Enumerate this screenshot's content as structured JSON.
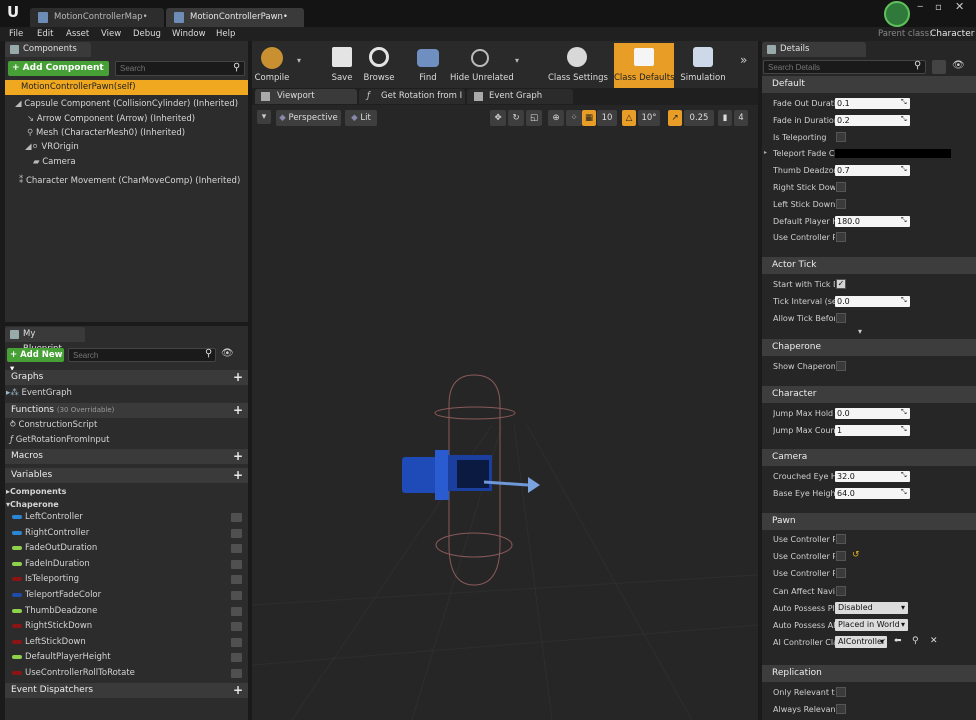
{
  "tabs": [
    {
      "label": "MotionControllerMap•"
    },
    {
      "label": "MotionControllerPawn•"
    }
  ],
  "parent_class": {
    "prefix": "Parent class:",
    "value": "Character"
  },
  "menu": [
    "File",
    "Edit",
    "Asset",
    "View",
    "Debug",
    "Window",
    "Help"
  ],
  "components": {
    "title": "Components",
    "add_label": "+ Add Component ▾",
    "search_placeholder": "Search",
    "root": "MotionControllerPawn(self)",
    "items": [
      "Capsule Component (CollisionCylinder) (Inherited)",
      "Arrow Component (Arrow) (Inherited)",
      "Mesh (CharacterMesh0) (Inherited)",
      "VROrigin",
      "Camera",
      "Character Movement (CharMoveComp) (Inherited)"
    ]
  },
  "blueprint": {
    "title": "My Blueprint",
    "add_label": "+ Add New ▾",
    "search_placeholder": "Search",
    "graphs": "Graphs",
    "event_graph": "EventGraph",
    "functions": "Functions",
    "functions_note": "(30 Overridable)",
    "fn_items": [
      "ConstructionScript",
      "GetRotationFromInput"
    ],
    "macros": "Macros",
    "variables": "Variables",
    "cat_components": "Components",
    "cat_chaperone": "Chaperone",
    "vars": [
      {
        "name": "LeftController",
        "color": "#2b87d6"
      },
      {
        "name": "RightController",
        "color": "#2b87d6"
      },
      {
        "name": "FadeOutDuration",
        "color": "#8ed14a"
      },
      {
        "name": "FadeInDuration",
        "color": "#8ed14a"
      },
      {
        "name": "IsTeleporting",
        "color": "#8b1515"
      },
      {
        "name": "TeleportFadeColor",
        "color": "#1f4ca8"
      },
      {
        "name": "ThumbDeadzone",
        "color": "#8ed14a"
      },
      {
        "name": "RightStickDown",
        "color": "#8b1515"
      },
      {
        "name": "LeftStickDown",
        "color": "#8b1515"
      },
      {
        "name": "DefaultPlayerHeight",
        "color": "#8ed14a"
      },
      {
        "name": "UseControllerRollToRotate",
        "color": "#8b1515"
      }
    ],
    "dispatchers": "Event Dispatchers"
  },
  "toolbar": {
    "compile": "Compile",
    "save": "Save",
    "browse": "Browse",
    "find": "Find",
    "hide": "Hide Unrelated",
    "class_settings": "Class Settings",
    "class_defaults": "Class Defaults",
    "simulation": "Simulation"
  },
  "viewport_tabs": [
    "Viewport",
    "Get Rotation from I",
    "Event Graph"
  ],
  "viewport": {
    "perspective": "Perspective",
    "lit": "Lit",
    "grid": "10",
    "angle": "10°",
    "scale": "0.25",
    "speed": "4"
  },
  "details": {
    "title": "Details",
    "search_placeholder": "Search Details",
    "default": {
      "title": "Default",
      "rows": [
        {
          "label": "Fade Out Duratio",
          "value": "0.1"
        },
        {
          "label": "Fade in Duration",
          "value": "0.2"
        },
        {
          "label": "Is Teleporting"
        },
        {
          "label": "Teleport Fade Co"
        },
        {
          "label": "Thumb Deadzone",
          "value": "0.7"
        },
        {
          "label": "Right Stick Down"
        },
        {
          "label": "Left Stick Down"
        },
        {
          "label": "Default Player He",
          "value": "180.0"
        },
        {
          "label": "Use Controller Ro"
        }
      ]
    },
    "actor_tick": {
      "title": "Actor Tick",
      "rows": [
        {
          "label": "Start with Tick En"
        },
        {
          "label": "Tick Interval (sec",
          "value": "0.0"
        },
        {
          "label": "Allow Tick Before"
        }
      ]
    },
    "chaperone": {
      "title": "Chaperone",
      "rows": [
        {
          "label": "Show Chaperone"
        }
      ]
    },
    "character": {
      "title": "Character",
      "rows": [
        {
          "label": "Jump Max Hold T",
          "value": "0.0"
        },
        {
          "label": "Jump Max Count",
          "value": "1"
        }
      ]
    },
    "camera": {
      "title": "Camera",
      "rows": [
        {
          "label": "Crouched Eye He",
          "value": "32.0"
        },
        {
          "label": "Base Eye Height",
          "value": "64.0"
        }
      ]
    },
    "pawn": {
      "title": "Pawn",
      "rows": [
        {
          "label": "Use Controller Ro"
        },
        {
          "label": "Use Controller Ro"
        },
        {
          "label": "Use Controller Ro"
        },
        {
          "label": "Can Affect Naviga"
        },
        {
          "label": "Auto Possess Pla",
          "value": "Disabled"
        },
        {
          "label": "Auto Possess AI",
          "value": "Placed in World"
        },
        {
          "label": "AI Controller Clas",
          "value": "AIController"
        }
      ]
    },
    "replication": {
      "title": "Replication",
      "rows": [
        {
          "label": "Only Relevant to C"
        },
        {
          "label": "Always Relevant"
        }
      ]
    }
  }
}
